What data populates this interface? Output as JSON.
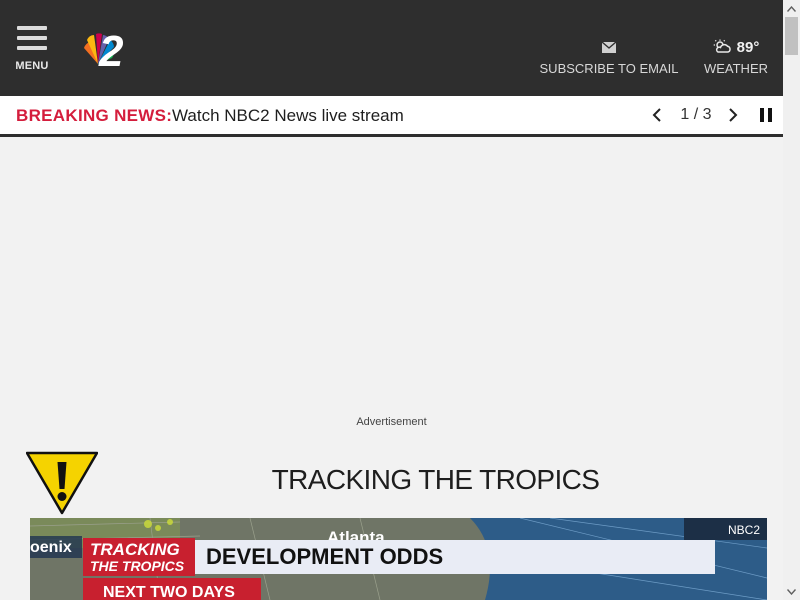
{
  "header": {
    "menu_label": "MENU",
    "logo_text": "2",
    "subscribe_label": "SUBSCRIBE TO EMAIL",
    "weather_temp": "89°",
    "weather_label": "WEATHER",
    "icons": [
      "menu-icon",
      "nbc-peacock-logo",
      "envelope-icon",
      "partly-cloudy-icon"
    ]
  },
  "breaking": {
    "label": "BREAKING NEWS:",
    "headline": "Watch NBC2 News live stream",
    "counter": "1 / 3",
    "icons": [
      "chevron-left-icon",
      "chevron-right-icon",
      "pause-icon"
    ]
  },
  "ad": {
    "label": "Advertisement"
  },
  "tropics": {
    "title": "TRACKING THE TROPICS",
    "video": {
      "city_left": "oenix",
      "city_top": "Atlanta",
      "badge_line1": "TRACKING",
      "badge_line2": "THE TROPICS",
      "banner": "DEVELOPMENT ODDS",
      "sub_banner": "NEXT TWO DAYS",
      "bug": "NBC2"
    }
  },
  "colors": {
    "header_bg": "#2e2e2e",
    "breaking_red": "#d41d3c",
    "page_bg": "#f2f2f2",
    "warning_yellow": "#f5d300"
  }
}
